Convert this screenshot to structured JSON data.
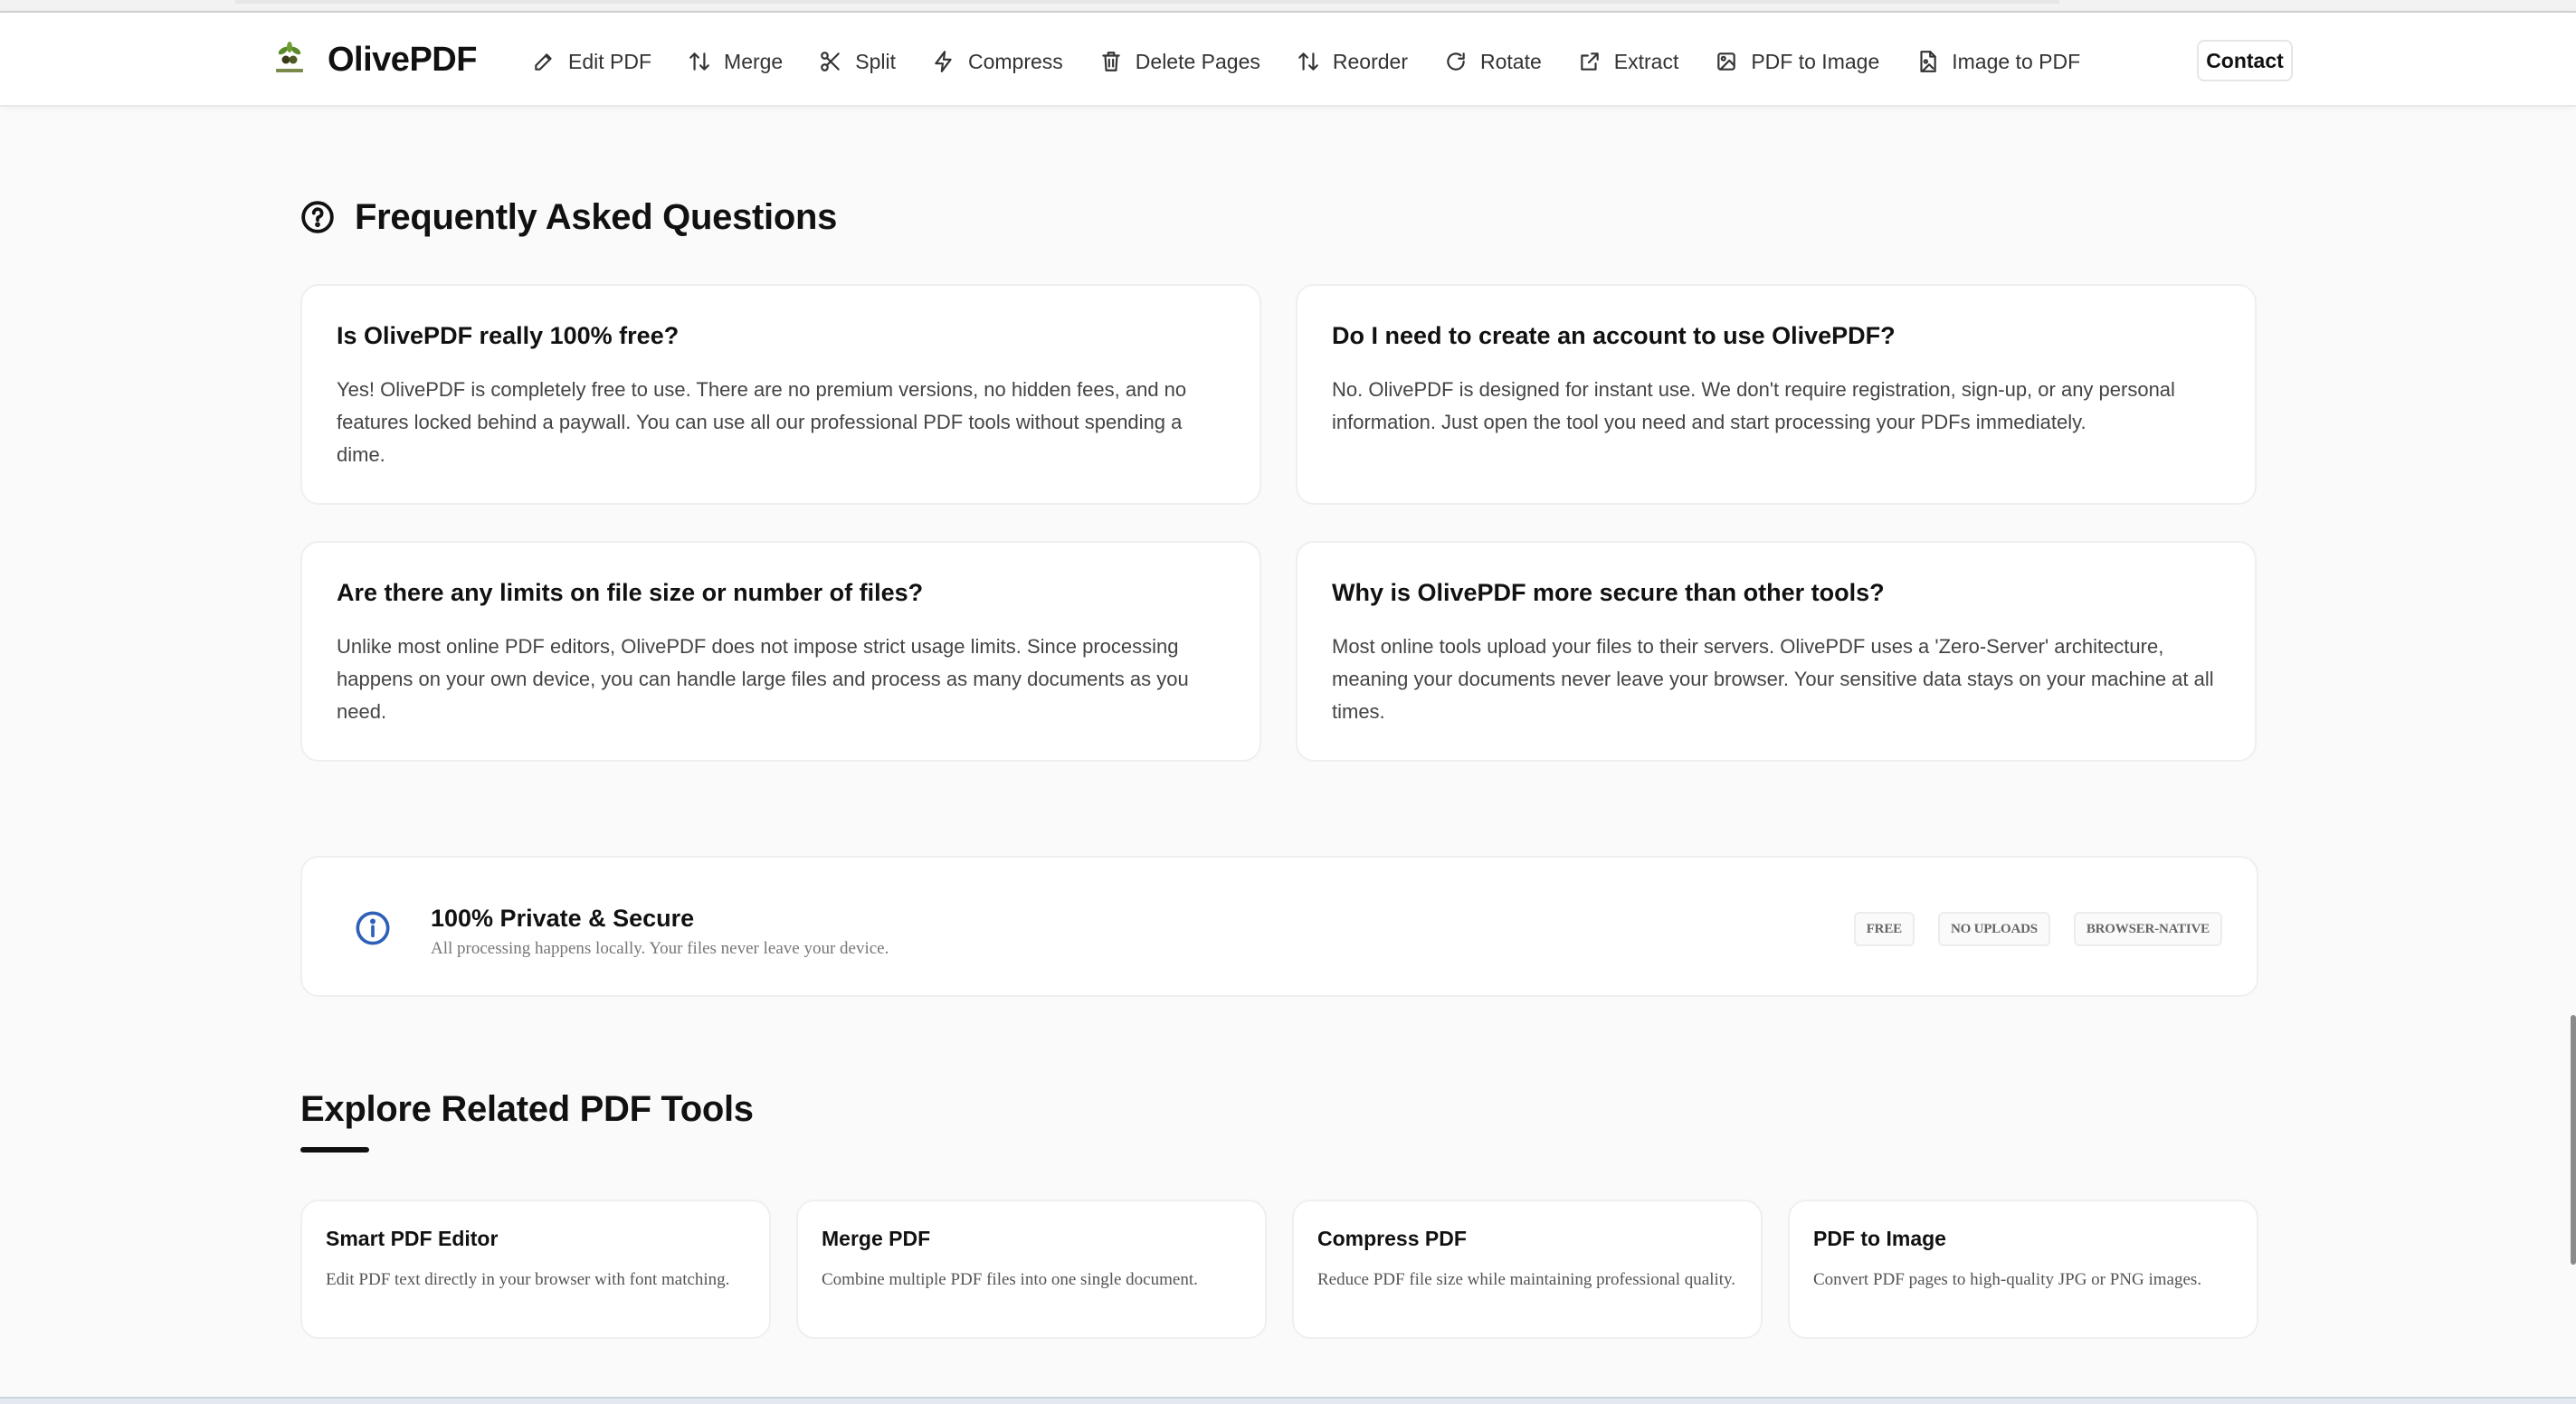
{
  "header": {
    "brand": "OlivePDF",
    "nav": [
      {
        "label": "Edit PDF",
        "icon": "pencil-icon"
      },
      {
        "label": "Merge",
        "icon": "arrows-up-down-icon"
      },
      {
        "label": "Split",
        "icon": "scissors-icon"
      },
      {
        "label": "Compress",
        "icon": "lightning-icon"
      },
      {
        "label": "Delete Pages",
        "icon": "trash-icon"
      },
      {
        "label": "Reorder",
        "icon": "arrows-up-down-icon"
      },
      {
        "label": "Rotate",
        "icon": "rotate-icon"
      },
      {
        "label": "Extract",
        "icon": "external-link-icon"
      },
      {
        "label": "PDF to Image",
        "icon": "image-icon"
      },
      {
        "label": "Image to PDF",
        "icon": "file-image-icon"
      }
    ],
    "contact": "Contact"
  },
  "faq": {
    "title": "Frequently Asked Questions",
    "items": [
      {
        "question": "Is OlivePDF really 100% free?",
        "answer": "Yes! OlivePDF is completely free to use. There are no premium versions, no hidden fees, and no features locked behind a paywall. You can use all our professional PDF tools without spending a dime."
      },
      {
        "question": "Do I need to create an account to use OlivePDF?",
        "answer": "No. OlivePDF is designed for instant use. We don't require registration, sign-up, or any personal information. Just open the tool you need and start processing your PDFs immediately."
      },
      {
        "question": "Are there any limits on file size or number of files?",
        "answer": "Unlike most online PDF editors, OlivePDF does not impose strict usage limits. Since processing happens on your own device, you can handle large files and process as many documents as you need."
      },
      {
        "question": "Why is OlivePDF more secure than other tools?",
        "answer": "Most online tools upload your files to their servers. OlivePDF uses a 'Zero-Server' architecture, meaning your documents never leave your browser. Your sensitive data stays on your machine at all times."
      }
    ]
  },
  "secure": {
    "title": "100% Private & Secure",
    "subtitle": "All processing happens locally. Your files never leave your device.",
    "badges": [
      "FREE",
      "NO UPLOADS",
      "BROWSER-NATIVE"
    ]
  },
  "related": {
    "title": "Explore Related PDF Tools",
    "tools": [
      {
        "name": "Smart PDF Editor",
        "description": "Edit PDF text directly in your browser with font matching."
      },
      {
        "name": "Merge PDF",
        "description": "Combine multiple PDF files into one single document."
      },
      {
        "name": "Compress PDF",
        "description": "Reduce PDF file size while maintaining professional quality."
      },
      {
        "name": "PDF to Image",
        "description": "Convert PDF pages to high-quality JPG or PNG images."
      }
    ]
  },
  "colors": {
    "info_icon": "#2f5fb8",
    "logo_green": "#5a8a2a",
    "text_primary": "#111111"
  }
}
